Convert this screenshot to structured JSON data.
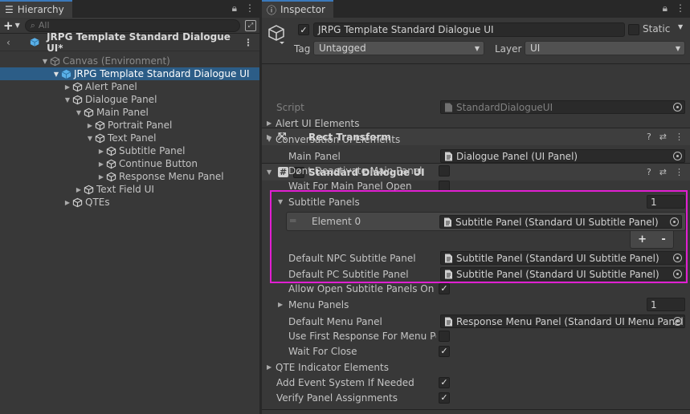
{
  "hierarchy": {
    "tab_label": "Hierarchy",
    "search_placeholder": "All",
    "scene_name": "JRPG Template Standard Dialogue UI*",
    "items": [
      {
        "label": "Canvas (Environment)"
      },
      {
        "label": "JRPG Template Standard Dialogue UI"
      },
      {
        "label": "Alert Panel"
      },
      {
        "label": "Dialogue Panel"
      },
      {
        "label": "Main Panel"
      },
      {
        "label": "Portrait Panel"
      },
      {
        "label": "Text Panel"
      },
      {
        "label": "Subtitle Panel"
      },
      {
        "label": "Continue Button"
      },
      {
        "label": "Response Menu Panel"
      },
      {
        "label": "Text Field UI"
      },
      {
        "label": "QTEs"
      }
    ]
  },
  "inspector": {
    "tab_label": "Inspector",
    "object_name": "JRPG Template Standard Dialogue UI",
    "static_label": "Static",
    "tag_label": "Tag",
    "tag_value": "Untagged",
    "layer_label": "Layer",
    "layer_value": "UI",
    "rect_transform": "Rect Transform",
    "component_title": "Standard Dialogue UI",
    "script_label": "Script",
    "script_value": "StandardDialogueUI",
    "alert_ui": "Alert UI Elements",
    "conversation_ui": "Conversation UI Elements",
    "main_panel_label": "Main Panel",
    "main_panel_value": "Dialogue Panel (UI Panel)",
    "dont_deactivate": "Dont Deactivate Main Panel",
    "wait_main": "Wait For Main Panel Open",
    "subtitle_panels": "Subtitle Panels",
    "subtitle_panels_count": "1",
    "element0_label": "Element 0",
    "element0_value": "Subtitle Panel (Standard UI Subtitle Panel)",
    "add_btn": "+",
    "remove_btn": "-",
    "default_npc_label": "Default NPC Subtitle Panel",
    "default_npc_value": "Subtitle Panel (Standard UI Subtitle Panel)",
    "default_pc_label": "Default PC Subtitle Panel",
    "default_pc_value": "Subtitle Panel (Standard UI Subtitle Panel)",
    "allow_open": "Allow Open Subtitle Panels On St",
    "menu_panels": "Menu Panels",
    "menu_panels_count": "1",
    "default_menu_label": "Default Menu Panel",
    "default_menu_value": "Response Menu Panel (Standard UI Menu Panel)",
    "use_first": "Use First Response For Menu Po",
    "wait_close": "Wait For Close",
    "qte": "QTE Indicator Elements",
    "add_event": "Add Event System If Needed",
    "verify": "Verify Panel Assignments"
  },
  "colors": {
    "accent_highlight": "#e11fd2",
    "selection": "#2c5d87"
  }
}
